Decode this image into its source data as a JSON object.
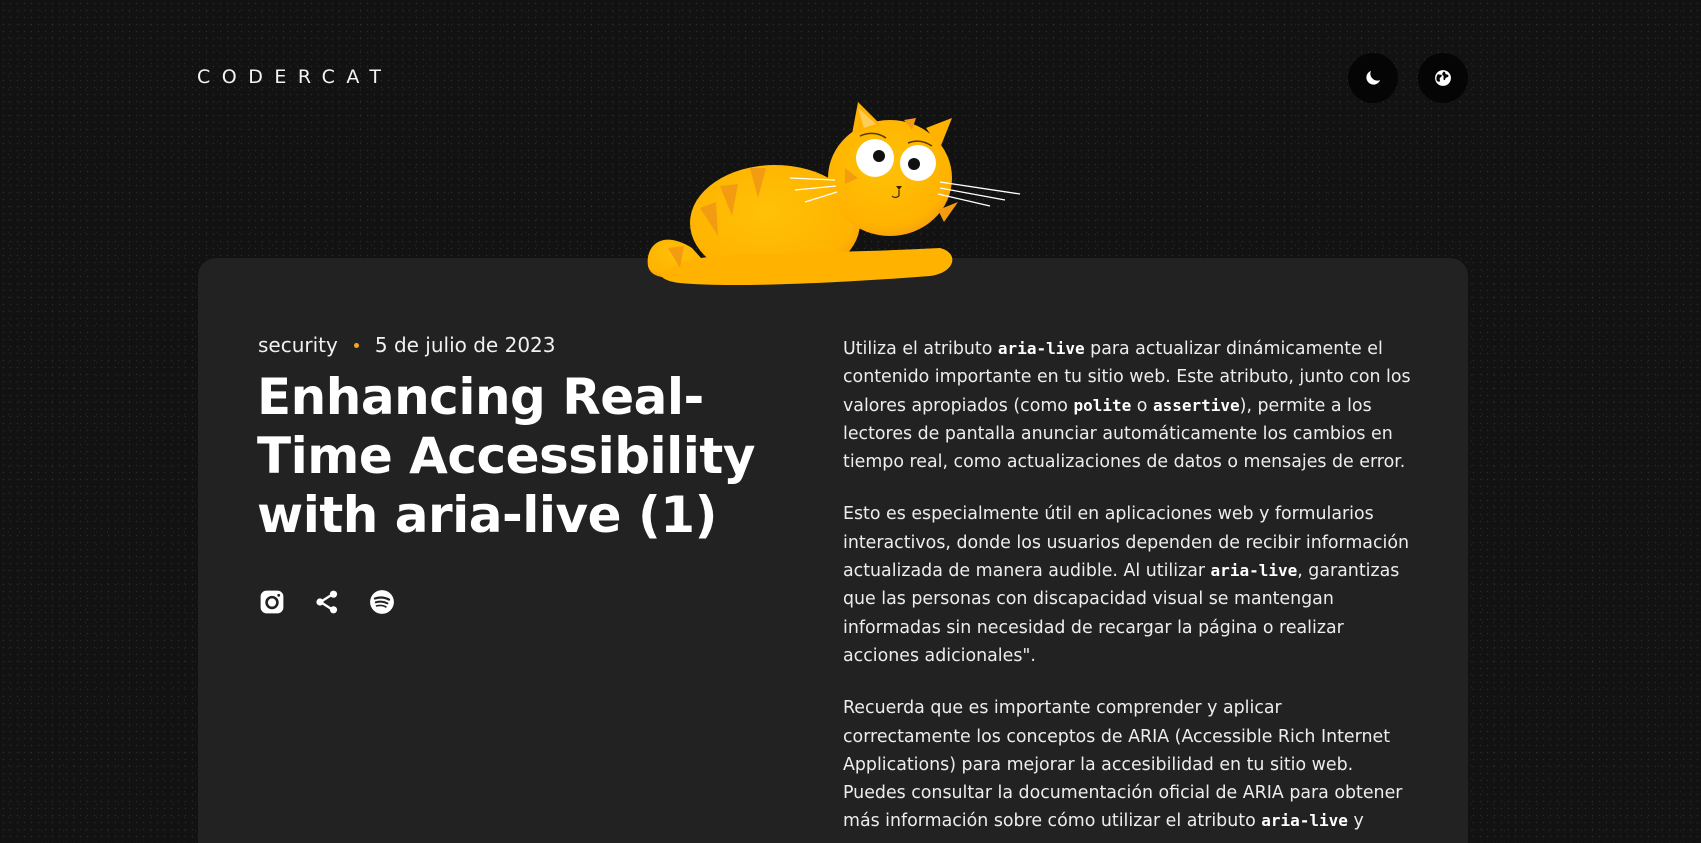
{
  "header": {
    "logo": "CODERCAT",
    "theme_icon": "moon-icon",
    "lang_icon": "globe-icon"
  },
  "post": {
    "category": "security",
    "date": "5 de julio de 2023",
    "title": "Enhancing Real-Time Accessibility with aria-live (1)",
    "share_icons": [
      "instagram-icon",
      "share-icon",
      "spotify-icon"
    ],
    "p1": {
      "t1": "Utiliza el atributo ",
      "c1": "aria-live",
      "t2": " para actualizar dinámicamente el contenido importante en tu sitio web. Este atributo, junto con los valores apropiados (como ",
      "c2": "polite",
      "t3": " o ",
      "c3": "assertive",
      "t4": "), permite a los lectores de pantalla anunciar automáticamente los cambios en tiempo real, como actualizaciones de datos o mensajes de error."
    },
    "p2": {
      "t1": "Esto es especialmente útil en aplicaciones web y formularios interactivos, donde los usuarios dependen de recibir información actualizada de manera audible. Al utilizar ",
      "c1": "aria-live",
      "t2": ", garantizas que las personas con discapacidad visual se mantengan informadas sin necesidad de recargar la página o realizar acciones adicionales\"."
    },
    "p3": {
      "t1": "Recuerda que es importante comprender y aplicar correctamente los conceptos de ARIA (Accessible Rich Internet Applications) para mejorar la accesibilidad en tu sitio web. Puedes consultar la documentación oficial de ARIA para obtener más información sobre cómo utilizar el atributo ",
      "c1": "aria-live",
      "t2": " y"
    }
  },
  "colors": {
    "background": "#121212",
    "card": "#222222",
    "accent": "#f5a623",
    "cat": "#ffb703"
  }
}
